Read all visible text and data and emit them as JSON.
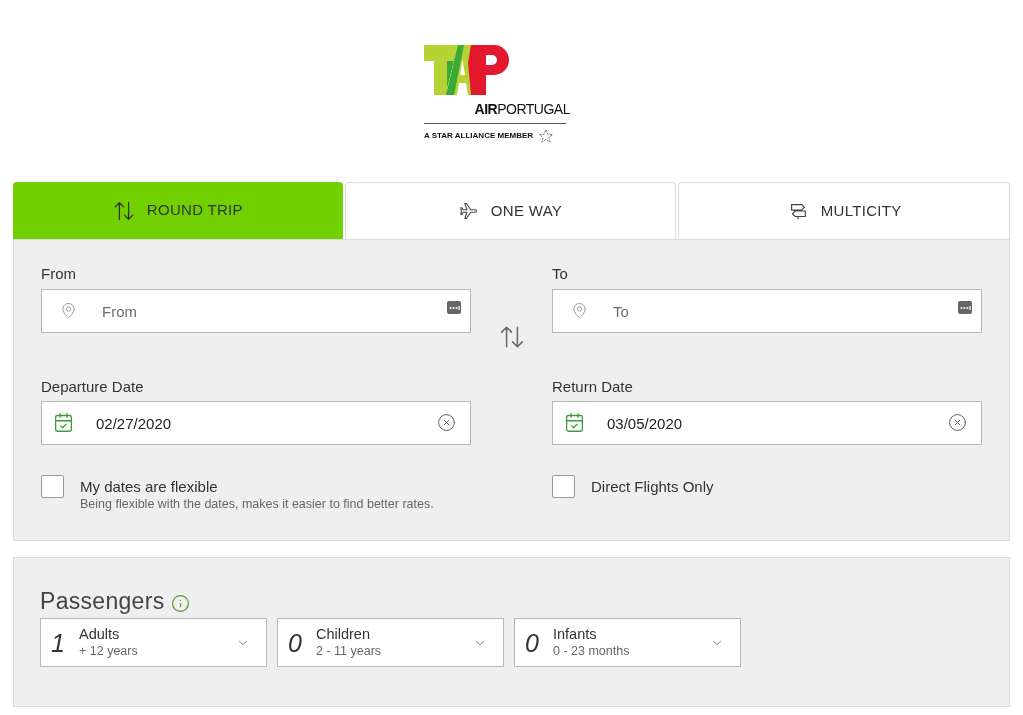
{
  "logo": {
    "wordmark": "**AIR**PORTUGAL",
    "tagline": "A STAR ALLIANCE MEMBER"
  },
  "trip_tabs": [
    {
      "kind": "round-trip",
      "label": "ROUND TRIP",
      "selected": true
    },
    {
      "kind": "one-way",
      "label": "ONE WAY",
      "selected": false
    },
    {
      "kind": "multicity",
      "label": "MULTICITY",
      "selected": false
    }
  ],
  "search_form": {
    "origin": {
      "label": "From",
      "placeholder": "From"
    },
    "destination": {
      "label": "To",
      "placeholder": "To"
    },
    "departure_date": {
      "label": "Departure Date",
      "value": "02/27/2020"
    },
    "return_date": {
      "label": "Return Date",
      "value": "03/05/2020"
    },
    "options": [
      {
        "label": "My dates are flexible",
        "hint": "Being flexible with the dates, makes it easier to find better rates.",
        "checked": false
      },
      {
        "label": "Direct Flights Only",
        "checked": false
      }
    ]
  },
  "passengers": {
    "title": "Passengers",
    "groups": [
      {
        "count": "1",
        "label": "Adults",
        "range": "+ 12 years"
      },
      {
        "count": "0",
        "label": "Children",
        "range": "2 - 11 years"
      },
      {
        "count": "0",
        "label": "Infants",
        "range": "0 - 23 months"
      }
    ]
  }
}
